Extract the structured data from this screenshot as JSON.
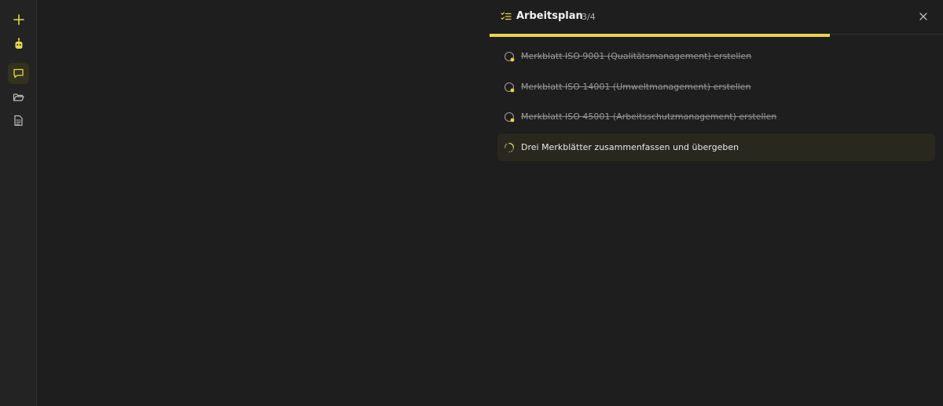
{
  "rail": {
    "items": [
      {
        "name": "new",
        "icon": "plus-icon"
      },
      {
        "name": "assistant",
        "icon": "robot-icon"
      },
      {
        "name": "chat",
        "icon": "chat-bubble-icon",
        "active": true
      },
      {
        "name": "files",
        "icon": "folder-open-icon"
      },
      {
        "name": "documents",
        "icon": "document-icon"
      }
    ]
  },
  "panel": {
    "title": "Arbeitsplan",
    "count": "3/4",
    "progress": 0.75,
    "tasks": [
      {
        "label": "Merkblatt ISO 9001 (Qualitätsmanagement) erstellen",
        "status": "done"
      },
      {
        "label": "Merkblatt ISO 14001 (Umweltmanagement) erstellen",
        "status": "done"
      },
      {
        "label": "Merkblatt ISO 45001 (Arbeitsschutzmanagement) erstellen",
        "status": "done"
      },
      {
        "label": "Drei Merkblätter zusammenfassen und übergeben",
        "status": "in-progress"
      }
    ]
  },
  "colors": {
    "accent": "#e5d64a",
    "background": "#1e1e1e",
    "rail": "#232323"
  }
}
